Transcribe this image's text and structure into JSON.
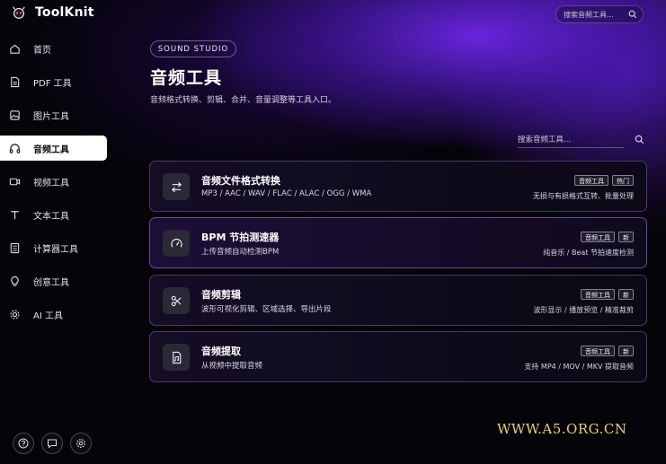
{
  "app": {
    "name": "ToolKnit"
  },
  "top_search": {
    "placeholder": "搜索音频工具..."
  },
  "sidebar": {
    "items": [
      {
        "label": "首页",
        "icon": "home-icon"
      },
      {
        "label": "PDF 工具",
        "icon": "document-icon"
      },
      {
        "label": "图片工具",
        "icon": "image-icon"
      },
      {
        "label": "音频工具",
        "icon": "headphones-icon",
        "active": true
      },
      {
        "label": "视频工具",
        "icon": "video-icon"
      },
      {
        "label": "文本工具",
        "icon": "text-icon"
      },
      {
        "label": "计算器工具",
        "icon": "calculator-icon"
      },
      {
        "label": "创意工具",
        "icon": "lightbulb-icon"
      },
      {
        "label": "AI 工具",
        "icon": "gear-ai-icon"
      }
    ],
    "bottom": [
      "help-icon",
      "feedback-icon",
      "settings-icon"
    ]
  },
  "hero": {
    "badge": "SOUND STUDIO",
    "title": "音频工具",
    "subtitle": "音频格式转换、剪辑、合并、音量调整等工具入口。"
  },
  "tool_search": {
    "placeholder": "搜索音频工具..."
  },
  "tools": [
    {
      "title": "音频文件格式转换",
      "desc": "MP3 / AAC / WAV / FLAC / ALAC / OGG / WMA",
      "tags": [
        "音频工具",
        "热门"
      ],
      "note": "无损与有损格式互转、批量处理",
      "icon": "swap-arrows-icon"
    },
    {
      "title": "BPM 节拍测速器",
      "desc": "上传音频自动检测BPM",
      "tags": [
        "音频工具",
        "新"
      ],
      "note": "纯音乐 / Beat 节拍速度检测",
      "icon": "gauge-icon"
    },
    {
      "title": "音频剪辑",
      "desc": "波形可视化剪辑、区域选择、导出片段",
      "tags": [
        "音频工具",
        "新"
      ],
      "note": "波形显示 / 播放预览 / 精准裁剪",
      "icon": "scissors-icon"
    },
    {
      "title": "音频提取",
      "desc": "从视频中提取音频",
      "tags": [
        "音频工具",
        "新"
      ],
      "note": "支持 MP4 / MOV / MKV 提取音频",
      "icon": "audio-file-icon"
    }
  ],
  "watermark": "WWW.A5.ORG.CN",
  "colors": {
    "accent": "#6c26e6",
    "background": "#050409",
    "watermark": "#e8d07a"
  }
}
